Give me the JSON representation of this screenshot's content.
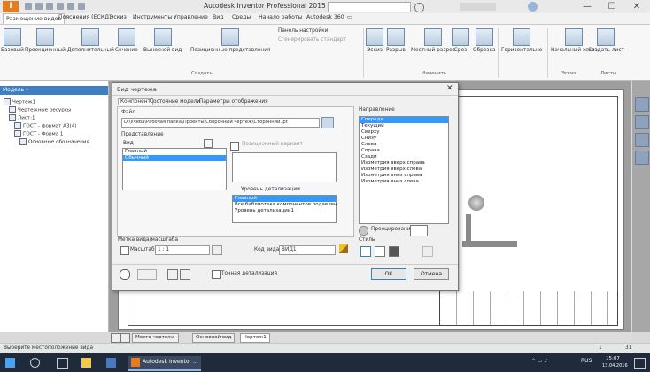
{
  "window": {
    "title": "Autodesk Inventor Professional 2015   Чертеж1",
    "app_letter": "I",
    "controls": [
      "—",
      "☐",
      "✕"
    ]
  },
  "ribbon_tabs": [
    "Размещение видов",
    "Пояснения (ЕСКД)",
    "Эскиз",
    "Инструменты",
    "Управление",
    "Вид",
    "Среды",
    "Начало работы",
    "Autodesk 360",
    "▭"
  ],
  "ribbon": {
    "buttons": [
      "Базовый",
      "Проекционный",
      "Дополнительный",
      "Сечение",
      "Выносной вид",
      "Позиционные представления",
      "Эскиз",
      "Разрыв",
      "Местный разрез",
      "Срез",
      "Обрезка",
      "Горизонтально",
      "Начальный эскиз",
      "Создать лист"
    ],
    "panel_labels": [
      "Панель настройки",
      "Сгенерировать стандарт"
    ],
    "groups": [
      "Создать",
      "Изменить",
      "Эскиз",
      "Листы"
    ]
  },
  "browser": {
    "title": "Модель ▾",
    "items": [
      "Чертеж1",
      "Чертежные ресурсы",
      "Лист:1",
      "ГОСТ - формат А3(4)",
      "ГОСТ - Форма 1",
      "Основные обозначения"
    ]
  },
  "dialog": {
    "title": "Вид чертежа",
    "close": "✕",
    "tabs": [
      "Компонент",
      "Состояние модели",
      "Параметры отображения"
    ],
    "file_label": "Файл",
    "file_path": "D:\\Учеба\\Рабочая папка\\Проекты\\Сборочный чертеж\\Сторонний.ipt",
    "representation_label": "Представление",
    "view_label": "Вид",
    "views": [
      "Главный",
      "Обычный"
    ],
    "position_label": "Позиционный вариант",
    "detail_label": "Уровень детализации",
    "detail_items": [
      "Главный",
      "Все библиотека компонентов подавлен",
      "Уровень детализации1"
    ],
    "orientation_label": "Направление",
    "orientation_items": [
      "Спереди",
      "Текущий",
      "Сверху",
      "Снизу",
      "Слева",
      "Справа",
      "Сзади",
      "Изометрия вверх справа",
      "Изометрия вверх слева",
      "Изометрия вниз справа",
      "Изометрия вниз слева"
    ],
    "projection_label": "Проецирование:",
    "scale_section": "Метка вида/масштаба",
    "scale_label": "Масштаб",
    "scale_value": "1 : 1",
    "view_id_label": "Код вида",
    "view_id_value": "ВИД1",
    "style_label": "Стиль",
    "shading_label": "Точная детализация",
    "ok": "ОК",
    "cancel": "Отмена"
  },
  "sheet_tabs": [
    "Место чертежа",
    "Основной вид",
    "Чертеж1"
  ],
  "status_text": "Выберите местоположение вида",
  "status_right": [
    "1",
    "31"
  ],
  "taskbar": {
    "app": "Autodesk Inventor ...",
    "time": "15:07",
    "date": "13.04.2016",
    "lang": "RUS"
  }
}
